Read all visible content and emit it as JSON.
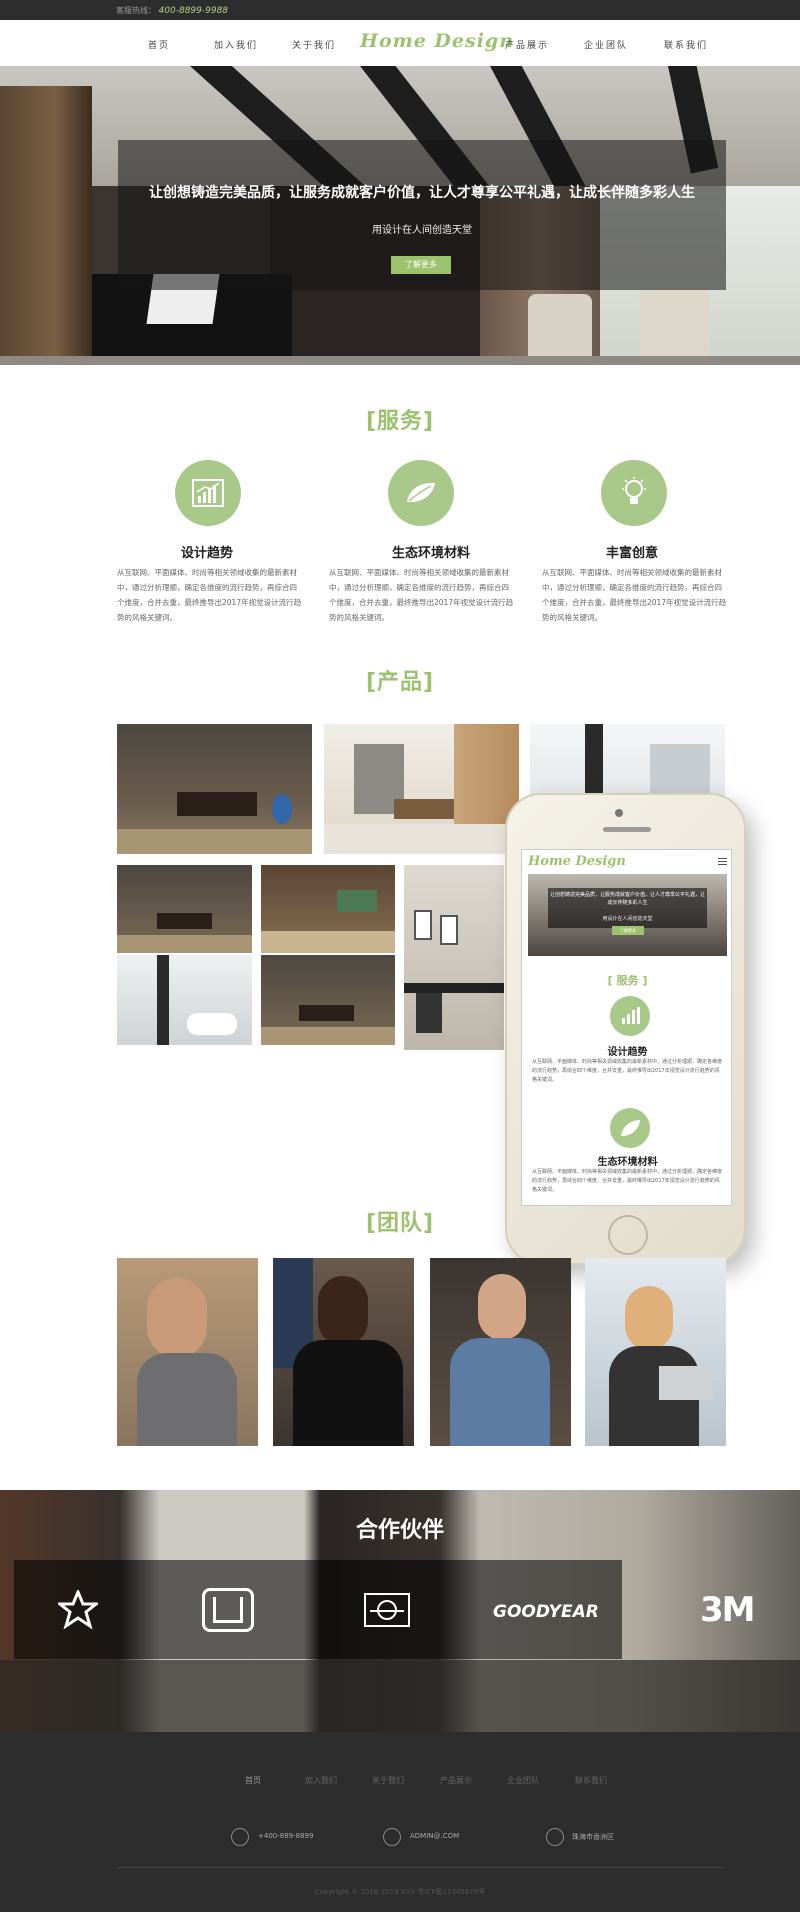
{
  "topbar": {
    "hotline_label": "客服热线：",
    "hotline_number": "400-8899-9988"
  },
  "nav": {
    "items": [
      "首页",
      "加入我们",
      "关于我们",
      "产品展示",
      "企业团队",
      "联系我们"
    ],
    "logo": "Home Design"
  },
  "hero": {
    "headline": "让创想铸造完美品质，让服务成就客户价值，让人才尊享公平礼遇，让成长伴随多彩人生",
    "subline": "用设计在人间创造天堂",
    "button": "了解更多"
  },
  "services": {
    "title": "[服务]",
    "items": [
      {
        "icon": "chart-icon",
        "title": "设计趋势",
        "desc": "从互联网、平面媒体、时尚等相关领域收集的最新素材中，通过分析理顺，确定各维度的流行趋势，再综合四个维度，合并去重，最终推导出2017年视觉设计流行趋势的风格关键词。"
      },
      {
        "icon": "leaf-icon",
        "title": "生态环境材料",
        "desc": "从互联网、平面媒体、时尚等相关领域收集的最新素材中，通过分析理顺，确定各维度的流行趋势，再综合四个维度，合并去重，最终推导出2017年视觉设计流行趋势的风格关键词。"
      },
      {
        "icon": "bulb-icon",
        "title": "丰富创意",
        "desc": "从互联网、平面媒体、时尚等相关领域收集的最新素材中，通过分析理顺，确定各维度的流行趋势，再综合四个维度，合并去重，最终推导出2017年视觉设计流行趋势的风格关键词。"
      }
    ]
  },
  "products": {
    "title": "[产品]"
  },
  "phone": {
    "logo": "Home Design",
    "hero_text": "让创想铸造完美品质，让服务成就客户价值，让人才尊享公平礼遇，让成长伴随多彩人生",
    "hero_sub": "用设计在人间创造天堂",
    "hero_button": "了解更多",
    "section": "[ 服务 ]",
    "item1_title": "设计趋势",
    "item1_desc": "从互联网、平面媒体、时尚等相关领域收集的最新素材中，通过分析理顺，确定各维度的流行趋势，再综合四个维度，合并去重，最终推导出2017年视觉设计流行趋势的风格关键词。",
    "item2_title": "生态环境材料",
    "item2_desc": "从互联网、平面媒体、时尚等相关领域收集的最新素材中，通过分析理顺，确定各维度的流行趋势，再综合四个维度，合并去重，最终推导出2017年视觉设计流行趋势的风格关键词。"
  },
  "team": {
    "title": "[团队]"
  },
  "partners": {
    "title": "合作伙伴",
    "logos": [
      "GOODYEAR",
      "3M"
    ]
  },
  "footer": {
    "nav": [
      "首页",
      "加入我们",
      "关于我们",
      "产品展示",
      "企业团队",
      "联系我们"
    ],
    "phone": "+400-889-8899",
    "email": "ADMIN@.COM",
    "address": "珠海市香洲区",
    "copyright": "Copyright © 2016-2019 XXX 粤ICP备12345678号"
  },
  "colors": {
    "accent": "#9cc26e",
    "dark": "#2d2d2d"
  }
}
